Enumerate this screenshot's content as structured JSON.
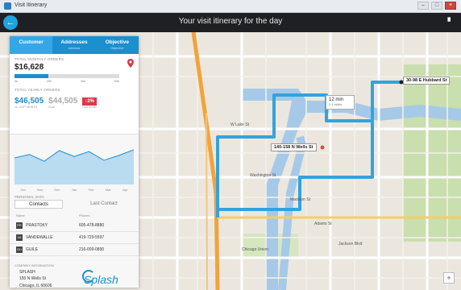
{
  "window": {
    "title": "Visit Itinerary",
    "controls": [
      "–",
      "□",
      "×"
    ]
  },
  "header": {
    "title": "Your visit itinerary for the day",
    "back_glyph": "←",
    "menu_glyph": "▘"
  },
  "tabs": [
    {
      "label": "Customer",
      "sub": ""
    },
    {
      "label": "Addresses",
      "sub": "Address"
    },
    {
      "label": "Objective",
      "sub": "Objective"
    }
  ],
  "monthly": {
    "label": "TOTAL MONTHLY ORDERS",
    "value": "$16,628",
    "progress_fraction": 0.32,
    "ticks": [
      "0k",
      "20k",
      "40k",
      "60k"
    ]
  },
  "yearly": {
    "label": "TOTAL YEARLY ORDERS",
    "current": "$46,505",
    "current_caption": "vs. LAST MONTH",
    "previous": "$44,505",
    "previous_caption": "Goal",
    "change": "↑2%",
    "change_caption": "Last month"
  },
  "trend": {
    "months": [
      "Oct",
      "Nov",
      "Dec",
      "Jan",
      "Feb",
      "Mar",
      "Apr"
    ],
    "values": [
      55,
      62,
      48,
      70,
      58,
      68,
      50,
      60,
      72
    ]
  },
  "segment": {
    "label": "PERSONAL DATA",
    "active": "Contacts",
    "inactive": "Last Contact"
  },
  "contacts": {
    "headers": [
      "Name",
      "Phones"
    ],
    "rows": [
      {
        "icon": "PR",
        "name": "PRASTOKY",
        "phone": "605-478-8880"
      },
      {
        "icon": "VA",
        "name": "VANDEWALLE",
        "phone": "419-729-5597"
      },
      {
        "icon": "GU",
        "name": "GUILE",
        "phone": "216-009-0890"
      }
    ]
  },
  "company": {
    "label": "COMPANY INFORMATION",
    "name": "SPLASH",
    "address": "150 N Wells St",
    "city": "Chicago, IL 60606",
    "logo": "Splash"
  },
  "map": {
    "labels": {
      "destination": "30-98 E Hubbard St",
      "origin": "140-158 N Wells St",
      "time": "12 min",
      "time_sub": "2.1 miles"
    },
    "zoom_glyph": "+",
    "route_color": "#33a3dc",
    "water_color": "#a6c9e8",
    "park_color": "#c9dfae"
  }
}
